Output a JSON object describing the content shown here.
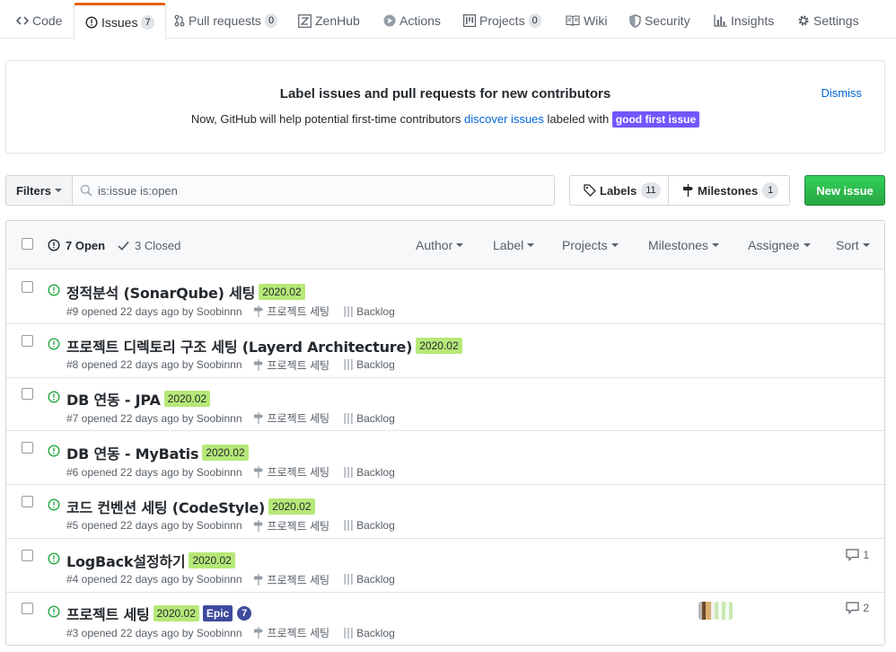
{
  "tabs": [
    {
      "label": "Code",
      "icon": "code-icon",
      "count": null
    },
    {
      "label": "Issues",
      "icon": "issue-opened-icon",
      "count": "7"
    },
    {
      "label": "Pull requests",
      "icon": "git-pull-request-icon",
      "count": "0"
    },
    {
      "label": "ZenHub",
      "icon": "zenhub-icon",
      "count": null
    },
    {
      "label": "Actions",
      "icon": "play-icon",
      "count": null
    },
    {
      "label": "Projects",
      "icon": "project-icon",
      "count": "0"
    },
    {
      "label": "Wiki",
      "icon": "book-icon",
      "count": null
    },
    {
      "label": "Security",
      "icon": "shield-icon",
      "count": null
    },
    {
      "label": "Insights",
      "icon": "graph-icon",
      "count": null
    },
    {
      "label": "Settings",
      "icon": "gear-icon",
      "count": null
    }
  ],
  "banner": {
    "title": "Label issues and pull requests for new contributors",
    "desc_before": "Now, GitHub will help potential first-time contributors ",
    "desc_link": "discover issues",
    "desc_after": " labeled with ",
    "label": "good first issue",
    "dismiss": "Dismiss"
  },
  "filters": {
    "filters_label": "Filters",
    "search_value": "is:issue is:open",
    "labels_label": "Labels",
    "labels_count": "11",
    "milestones_label": "Milestones",
    "milestones_count": "1",
    "new_issue": "New issue"
  },
  "list_header": {
    "open": "7 Open",
    "closed": "3 Closed",
    "author": "Author",
    "label": "Label",
    "projects": "Projects",
    "milestones": "Milestones",
    "assignee": "Assignee",
    "sort": "Sort"
  },
  "issues": [
    {
      "title": "정적분석 (SonarQube) 세팅",
      "label": "2020.02",
      "meta": "#9 opened 22 days ago by Soobinnn",
      "milestone": "프로젝트 세팅",
      "project": "Backlog",
      "comments": ""
    },
    {
      "title": "프로젝트 디렉토리 구조 세팅 (Layerd Architecture)",
      "label": "2020.02",
      "meta": "#8 opened 22 days ago by Soobinnn",
      "milestone": "프로젝트 세팅",
      "project": "Backlog",
      "comments": ""
    },
    {
      "title": "DB 연동 - JPA",
      "label": "2020.02",
      "meta": "#7 opened 22 days ago by Soobinnn",
      "milestone": "프로젝트 세팅",
      "project": "Backlog",
      "comments": ""
    },
    {
      "title": "DB 연동 - MyBatis",
      "label": "2020.02",
      "meta": "#6 opened 22 days ago by Soobinnn",
      "milestone": "프로젝트 세팅",
      "project": "Backlog",
      "comments": ""
    },
    {
      "title": "코드 컨벤션 세팅 (CodeStyle)",
      "label": "2020.02",
      "meta": "#5 opened 22 days ago by Soobinnn",
      "milestone": "프로젝트 세팅",
      "project": "Backlog",
      "comments": ""
    },
    {
      "title": "LogBack설정하기",
      "label": "2020.02",
      "meta": "#4 opened 22 days ago by Soobinnn",
      "milestone": "프로젝트 세팅",
      "project": "Backlog",
      "comments": "1"
    },
    {
      "title": "프로젝트 세팅",
      "label": "2020.02",
      "epic": "Epic",
      "epic_count": "7",
      "meta": "#3 opened 22 days ago by Soobinnn",
      "milestone": "프로젝트 세팅",
      "project": "Backlog",
      "comments": "2"
    }
  ],
  "colors": {
    "accent": "#e36209",
    "link": "#0366d6",
    "open_green": "#28a745",
    "label_date": "#b6e878",
    "label_epic": "#3e4b9e",
    "good_first_issue": "#7057ff"
  }
}
